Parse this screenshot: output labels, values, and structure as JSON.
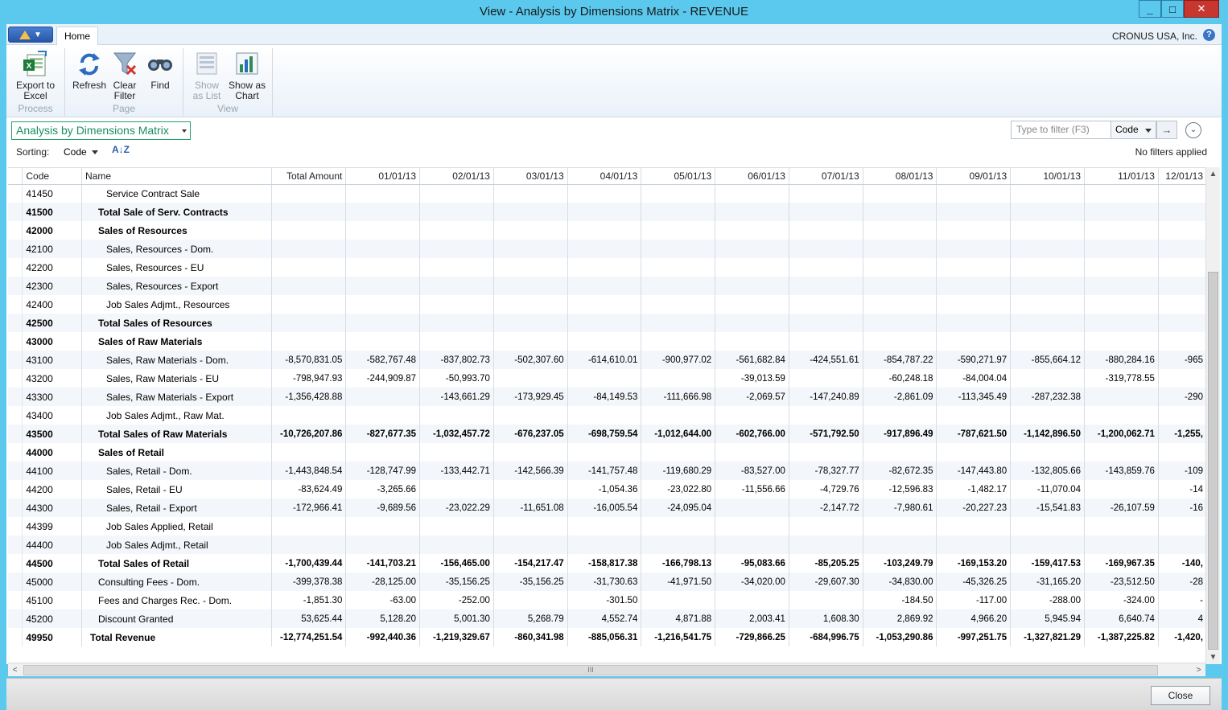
{
  "window": {
    "title": "View - Analysis by Dimensions Matrix - REVENUE",
    "min_label": "_",
    "max_label": "□",
    "close_label": "✕"
  },
  "ribbon": {
    "tab_home": "Home",
    "company": "CRONUS USA, Inc.",
    "help": "?",
    "groups": {
      "process": "Process",
      "page": "Page",
      "view": "View"
    },
    "buttons": {
      "export_excel_1": "Export to",
      "export_excel_2": "Excel",
      "refresh": "Refresh",
      "clear_filter_1": "Clear",
      "clear_filter_2": "Filter",
      "find": "Find",
      "show_list_1": "Show",
      "show_list_2": "as List",
      "show_chart_1": "Show as",
      "show_chart_2": "Chart"
    }
  },
  "toolbar": {
    "view_select": "Analysis by Dimensions Matrix",
    "sorting_label": "Sorting:",
    "sorting_value": "Code",
    "sort_dir": "A↓Z",
    "filter_placeholder": "Type to filter (F3)",
    "filter_field": "Code",
    "filter_go": "→",
    "expand": "⌄",
    "no_filters": "No filters applied"
  },
  "grid": {
    "columns": [
      "Code",
      "Name",
      "Total Amount",
      "01/01/13",
      "02/01/13",
      "03/01/13",
      "04/01/13",
      "05/01/13",
      "06/01/13",
      "07/01/13",
      "08/01/13",
      "09/01/13",
      "10/01/13",
      "11/01/13",
      "12/01/13"
    ],
    "rows": [
      {
        "code": "41450",
        "name": "Service Contract Sale",
        "indent": 2,
        "bold": false,
        "values": [
          "",
          "",
          "",
          "",
          "",
          "",
          "",
          "",
          "",
          "",
          "",
          "",
          ""
        ]
      },
      {
        "code": "41500",
        "name": "Total Sale of Serv. Contracts",
        "indent": 1,
        "bold": true,
        "values": [
          "",
          "",
          "",
          "",
          "",
          "",
          "",
          "",
          "",
          "",
          "",
          "",
          ""
        ]
      },
      {
        "code": "42000",
        "name": "Sales of Resources",
        "indent": 1,
        "bold": true,
        "values": [
          "",
          "",
          "",
          "",
          "",
          "",
          "",
          "",
          "",
          "",
          "",
          "",
          ""
        ]
      },
      {
        "code": "42100",
        "name": "Sales, Resources - Dom.",
        "indent": 2,
        "bold": false,
        "values": [
          "",
          "",
          "",
          "",
          "",
          "",
          "",
          "",
          "",
          "",
          "",
          "",
          ""
        ]
      },
      {
        "code": "42200",
        "name": "Sales, Resources - EU",
        "indent": 2,
        "bold": false,
        "values": [
          "",
          "",
          "",
          "",
          "",
          "",
          "",
          "",
          "",
          "",
          "",
          "",
          ""
        ]
      },
      {
        "code": "42300",
        "name": "Sales, Resources - Export",
        "indent": 2,
        "bold": false,
        "values": [
          "",
          "",
          "",
          "",
          "",
          "",
          "",
          "",
          "",
          "",
          "",
          "",
          ""
        ]
      },
      {
        "code": "42400",
        "name": "Job Sales Adjmt., Resources",
        "indent": 2,
        "bold": false,
        "values": [
          "",
          "",
          "",
          "",
          "",
          "",
          "",
          "",
          "",
          "",
          "",
          "",
          ""
        ]
      },
      {
        "code": "42500",
        "name": "Total Sales of Resources",
        "indent": 1,
        "bold": true,
        "values": [
          "",
          "",
          "",
          "",
          "",
          "",
          "",
          "",
          "",
          "",
          "",
          "",
          ""
        ]
      },
      {
        "code": "43000",
        "name": "Sales of Raw Materials",
        "indent": 1,
        "bold": true,
        "values": [
          "",
          "",
          "",
          "",
          "",
          "",
          "",
          "",
          "",
          "",
          "",
          "",
          ""
        ]
      },
      {
        "code": "43100",
        "name": "Sales, Raw Materials - Dom.",
        "indent": 2,
        "bold": false,
        "values": [
          "-8,570,831.05",
          "-582,767.48",
          "-837,802.73",
          "-502,307.60",
          "-614,610.01",
          "-900,977.02",
          "-561,682.84",
          "-424,551.61",
          "-854,787.22",
          "-590,271.97",
          "-855,664.12",
          "-880,284.16",
          "-965"
        ]
      },
      {
        "code": "43200",
        "name": "Sales, Raw Materials - EU",
        "indent": 2,
        "bold": false,
        "values": [
          "-798,947.93",
          "-244,909.87",
          "-50,993.70",
          "",
          "",
          "",
          "-39,013.59",
          "",
          "-60,248.18",
          "-84,004.04",
          "",
          "-319,778.55",
          ""
        ]
      },
      {
        "code": "43300",
        "name": "Sales, Raw Materials - Export",
        "indent": 2,
        "bold": false,
        "values": [
          "-1,356,428.88",
          "",
          "-143,661.29",
          "-173,929.45",
          "-84,149.53",
          "-111,666.98",
          "-2,069.57",
          "-147,240.89",
          "-2,861.09",
          "-113,345.49",
          "-287,232.38",
          "",
          "-290"
        ]
      },
      {
        "code": "43400",
        "name": "Job Sales Adjmt., Raw Mat.",
        "indent": 2,
        "bold": false,
        "values": [
          "",
          "",
          "",
          "",
          "",
          "",
          "",
          "",
          "",
          "",
          "",
          "",
          ""
        ]
      },
      {
        "code": "43500",
        "name": "Total Sales of Raw Materials",
        "indent": 1,
        "bold": true,
        "values": [
          "-10,726,207.86",
          "-827,677.35",
          "-1,032,457.72",
          "-676,237.05",
          "-698,759.54",
          "-1,012,644.00",
          "-602,766.00",
          "-571,792.50",
          "-917,896.49",
          "-787,621.50",
          "-1,142,896.50",
          "-1,200,062.71",
          "-1,255,"
        ]
      },
      {
        "code": "44000",
        "name": "Sales of Retail",
        "indent": 1,
        "bold": true,
        "values": [
          "",
          "",
          "",
          "",
          "",
          "",
          "",
          "",
          "",
          "",
          "",
          "",
          ""
        ]
      },
      {
        "code": "44100",
        "name": "Sales, Retail - Dom.",
        "indent": 2,
        "bold": false,
        "values": [
          "-1,443,848.54",
          "-128,747.99",
          "-133,442.71",
          "-142,566.39",
          "-141,757.48",
          "-119,680.29",
          "-83,527.00",
          "-78,327.77",
          "-82,672.35",
          "-147,443.80",
          "-132,805.66",
          "-143,859.76",
          "-109"
        ]
      },
      {
        "code": "44200",
        "name": "Sales, Retail - EU",
        "indent": 2,
        "bold": false,
        "values": [
          "-83,624.49",
          "-3,265.66",
          "",
          "",
          "-1,054.36",
          "-23,022.80",
          "-11,556.66",
          "-4,729.76",
          "-12,596.83",
          "-1,482.17",
          "-11,070.04",
          "",
          "-14"
        ]
      },
      {
        "code": "44300",
        "name": "Sales, Retail - Export",
        "indent": 2,
        "bold": false,
        "values": [
          "-172,966.41",
          "-9,689.56",
          "-23,022.29",
          "-11,651.08",
          "-16,005.54",
          "-24,095.04",
          "",
          "-2,147.72",
          "-7,980.61",
          "-20,227.23",
          "-15,541.83",
          "-26,107.59",
          "-16"
        ]
      },
      {
        "code": "44399",
        "name": "Job Sales Applied, Retail",
        "indent": 2,
        "bold": false,
        "values": [
          "",
          "",
          "",
          "",
          "",
          "",
          "",
          "",
          "",
          "",
          "",
          "",
          ""
        ]
      },
      {
        "code": "44400",
        "name": "Job Sales Adjmt., Retail",
        "indent": 2,
        "bold": false,
        "values": [
          "",
          "",
          "",
          "",
          "",
          "",
          "",
          "",
          "",
          "",
          "",
          "",
          ""
        ]
      },
      {
        "code": "44500",
        "name": "Total Sales of Retail",
        "indent": 1,
        "bold": true,
        "values": [
          "-1,700,439.44",
          "-141,703.21",
          "-156,465.00",
          "-154,217.47",
          "-158,817.38",
          "-166,798.13",
          "-95,083.66",
          "-85,205.25",
          "-103,249.79",
          "-169,153.20",
          "-159,417.53",
          "-169,967.35",
          "-140,"
        ]
      },
      {
        "code": "45000",
        "name": "Consulting Fees - Dom.",
        "indent": 1,
        "bold": false,
        "values": [
          "-399,378.38",
          "-28,125.00",
          "-35,156.25",
          "-35,156.25",
          "-31,730.63",
          "-41,971.50",
          "-34,020.00",
          "-29,607.30",
          "-34,830.00",
          "-45,326.25",
          "-31,165.20",
          "-23,512.50",
          "-28"
        ]
      },
      {
        "code": "45100",
        "name": "Fees and Charges Rec. - Dom.",
        "indent": 1,
        "bold": false,
        "values": [
          "-1,851.30",
          "-63.00",
          "-252.00",
          "",
          "-301.50",
          "",
          "",
          "",
          "-184.50",
          "-117.00",
          "-288.00",
          "-324.00",
          "-"
        ]
      },
      {
        "code": "45200",
        "name": "Discount Granted",
        "indent": 1,
        "bold": false,
        "values": [
          "53,625.44",
          "5,128.20",
          "5,001.30",
          "5,268.79",
          "4,552.74",
          "4,871.88",
          "2,003.41",
          "1,608.30",
          "2,869.92",
          "4,966.20",
          "5,945.94",
          "6,640.74",
          "4"
        ]
      },
      {
        "code": "49950",
        "name": "Total Revenue",
        "indent": 0,
        "bold": true,
        "values": [
          "-12,774,251.54",
          "-992,440.36",
          "-1,219,329.67",
          "-860,341.98",
          "-885,056.31",
          "-1,216,541.75",
          "-729,866.25",
          "-684,996.75",
          "-1,053,290.86",
          "-997,251.75",
          "-1,327,821.29",
          "-1,387,225.82",
          "-1,420,"
        ]
      }
    ]
  },
  "scroll": {
    "up": "▲",
    "down": "▼",
    "left": "<",
    "right": ">",
    "grip": "III"
  },
  "footer": {
    "close_label": "Close"
  }
}
